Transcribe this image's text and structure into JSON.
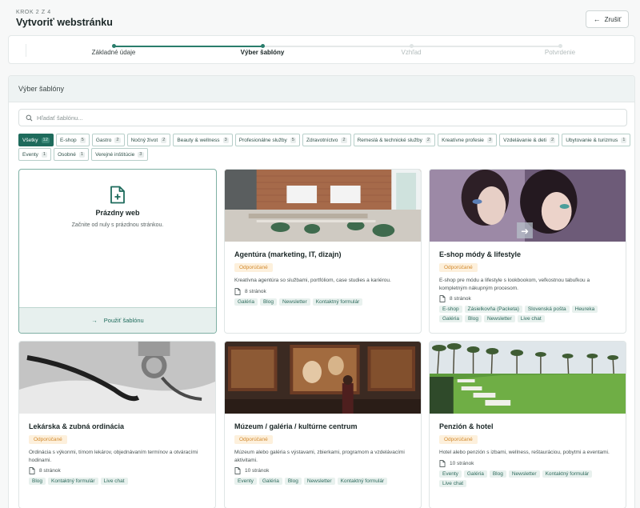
{
  "header": {
    "step_label": "KROK 2 Z 4",
    "title": "Vytvoriť webstránku",
    "cancel_label": "Zrušiť"
  },
  "stepper": {
    "steps": [
      {
        "label": "Základné údaje",
        "state": "done"
      },
      {
        "label": "Výber šablóny",
        "state": "active"
      },
      {
        "label": "Vzhľad",
        "state": "pending"
      },
      {
        "label": "Potvrdenie",
        "state": "pending"
      }
    ]
  },
  "panel": {
    "title": "Výber šablóny",
    "search_placeholder": "Hľadať šablónu..."
  },
  "categories": [
    {
      "label": "Všetky",
      "count": "12",
      "active": true
    },
    {
      "label": "E-shop",
      "count": "5"
    },
    {
      "label": "Gastro",
      "count": "2"
    },
    {
      "label": "Nočný život",
      "count": "2"
    },
    {
      "label": "Beauty & wellness",
      "count": "3"
    },
    {
      "label": "Profesionálne služby",
      "count": "5"
    },
    {
      "label": "Zdravotníctvo",
      "count": "2"
    },
    {
      "label": "Remeslá & technické služby",
      "count": "2"
    },
    {
      "label": "Kreatívne profesie",
      "count": "3"
    },
    {
      "label": "Vzdelávanie & deti",
      "count": "2"
    },
    {
      "label": "Ubytovanie & turizmus",
      "count": "1"
    },
    {
      "label": "Eventy",
      "count": "1"
    },
    {
      "label": "Osobné",
      "count": "1"
    },
    {
      "label": "Verejné inštitúcie",
      "count": "3"
    }
  ],
  "blank_template": {
    "title": "Prázdny web",
    "subtitle": "Začnite od nuly s prázdnou stránkou.",
    "use_label": "Použiť šablónu"
  },
  "templates": [
    {
      "title": "Agentúra (marketing, IT, dizajn)",
      "badge": "Odporúčané",
      "description": "Kreatívna agentúra so službami, portfóliom, case studies a kariérou.",
      "pages": "8 stránok",
      "tags": [
        "Galéria",
        "Blog",
        "Newsletter",
        "Kontaktný formulár"
      ],
      "image": "office-photo"
    },
    {
      "title": "E-shop módy & lifestyle",
      "badge": "Odporúčané",
      "description": "E-shop pre módu a lifestyle s lookbookom, veľkostnou tabuľkou a kompletným nákupným procesom.",
      "pages": "8 stránok",
      "tags": [
        "E-shop",
        "Zásielkovňa (Packeta)",
        "Slovenská pošta",
        "Heureka",
        "Galéria",
        "Blog",
        "Newsletter",
        "Live chat"
      ],
      "image": "fashion-photo"
    },
    {
      "title": "Lekárska & zubná ordinácia",
      "badge": "Odporúčané",
      "description": "Ordinácia s výkonmi, tímom lekárov, objednávaním termínov a otváracími hodinami.",
      "pages": "8 stránok",
      "tags": [
        "Blog",
        "Kontaktný formulár",
        "Live chat"
      ],
      "image": "stethoscope-photo"
    },
    {
      "title": "Múzeum / galéria / kultúrne centrum",
      "badge": "Odporúčané",
      "description": "Múzeum alebo galéria s výstavami, zbierkami, programom a vzdelávacími aktivitami.",
      "pages": "10 stránok",
      "tags": [
        "Eventy",
        "Galéria",
        "Blog",
        "Newsletter",
        "Kontaktný formulár"
      ],
      "image": "museum-photo"
    },
    {
      "title": "Penzión & hotel",
      "badge": "Odporúčané",
      "description": "Hotel alebo penzión s izbami, wellness, reštauráciou, pobytmi a eventami.",
      "pages": "10 stránok",
      "tags": [
        "Eventy",
        "Galéria",
        "Blog",
        "Newsletter",
        "Kontaktný formulár",
        "Live chat"
      ],
      "image": "hotel-photo"
    }
  ],
  "colors": {
    "accent": "#1e6b5c",
    "badge_bg": "#fdf0dc",
    "badge_text": "#d28a2f",
    "tag_bg": "#e8f1ee"
  }
}
